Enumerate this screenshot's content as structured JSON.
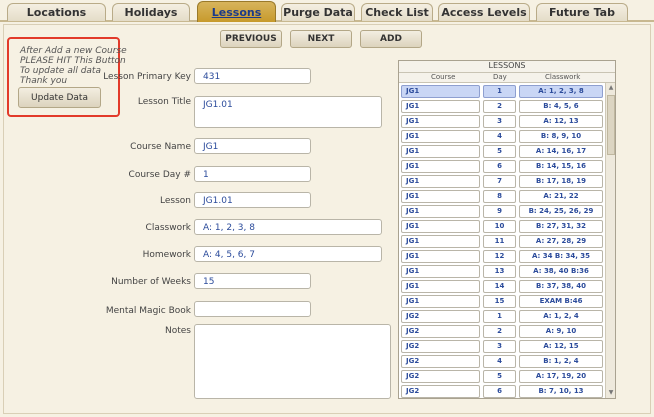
{
  "tabs": [
    {
      "label": "Locations",
      "active": false
    },
    {
      "label": "Holidays",
      "active": false
    },
    {
      "label": "Lessons",
      "active": true
    },
    {
      "label": "Purge Data",
      "active": false
    },
    {
      "label": "Check List",
      "active": false
    },
    {
      "label": "Access Levels",
      "active": false
    },
    {
      "label": "Future Tab",
      "active": false
    }
  ],
  "notice": {
    "text": "After Add a new Course\nPLEASE HIT This Button\nTo update all data\nThank you",
    "button": "Update Data"
  },
  "toolbar": {
    "previous": "PREVIOUS",
    "next": "NEXT",
    "add": "ADD"
  },
  "form": {
    "lesson_primary_key": {
      "label": "Lesson Primary Key",
      "value": "431"
    },
    "lesson_title": {
      "label": "Lesson Title",
      "value": "JG1.01"
    },
    "course_name": {
      "label": "Course Name",
      "value": "JG1"
    },
    "course_day": {
      "label": "Course Day #",
      "value": "1"
    },
    "lesson": {
      "label": "Lesson",
      "value": "JG1.01"
    },
    "classwork": {
      "label": "Classwork",
      "value": "A: 1, 2, 3, 8"
    },
    "homework": {
      "label": "Homework",
      "value": "A: 4, 5, 6, 7"
    },
    "weeks": {
      "label": "Number of Weeks",
      "value": "15"
    },
    "mental_magic_book": {
      "label": "Mental Magic Book",
      "value": ""
    },
    "notes": {
      "label": "Notes",
      "value": ""
    }
  },
  "lessons_table": {
    "title": "LESSONS",
    "columns": [
      "Course",
      "Day",
      "Classwork"
    ],
    "rows": [
      {
        "course": "JG1",
        "day": "1",
        "classwork": "A: 1, 2, 3, 8",
        "selected": true
      },
      {
        "course": "JG1",
        "day": "2",
        "classwork": "B: 4, 5, 6"
      },
      {
        "course": "JG1",
        "day": "3",
        "classwork": "A: 12, 13"
      },
      {
        "course": "JG1",
        "day": "4",
        "classwork": "B: 8, 9, 10"
      },
      {
        "course": "JG1",
        "day": "5",
        "classwork": "A: 14, 16, 17"
      },
      {
        "course": "JG1",
        "day": "6",
        "classwork": "B: 14, 15, 16"
      },
      {
        "course": "JG1",
        "day": "7",
        "classwork": "B: 17, 18, 19"
      },
      {
        "course": "JG1",
        "day": "8",
        "classwork": "A: 21, 22"
      },
      {
        "course": "JG1",
        "day": "9",
        "classwork": "B: 24, 25, 26, 29"
      },
      {
        "course": "JG1",
        "day": "10",
        "classwork": "B: 27, 31, 32"
      },
      {
        "course": "JG1",
        "day": "11",
        "classwork": "A: 27, 28, 29"
      },
      {
        "course": "JG1",
        "day": "12",
        "classwork": "A: 34  B: 34, 35"
      },
      {
        "course": "JG1",
        "day": "13",
        "classwork": "A: 38, 40  B:36"
      },
      {
        "course": "JG1",
        "day": "14",
        "classwork": "B: 37, 38, 40"
      },
      {
        "course": "JG1",
        "day": "15",
        "classwork": "EXAM  B:46"
      },
      {
        "course": "JG2",
        "day": "1",
        "classwork": "A: 1, 2, 4"
      },
      {
        "course": "JG2",
        "day": "2",
        "classwork": "A: 9, 10"
      },
      {
        "course": "JG2",
        "day": "3",
        "classwork": "A: 12, 15"
      },
      {
        "course": "JG2",
        "day": "4",
        "classwork": "B: 1, 2, 4"
      },
      {
        "course": "JG2",
        "day": "5",
        "classwork": "A: 17, 19, 20"
      },
      {
        "course": "JG2",
        "day": "6",
        "classwork": "B: 7, 10, 13"
      }
    ]
  }
}
